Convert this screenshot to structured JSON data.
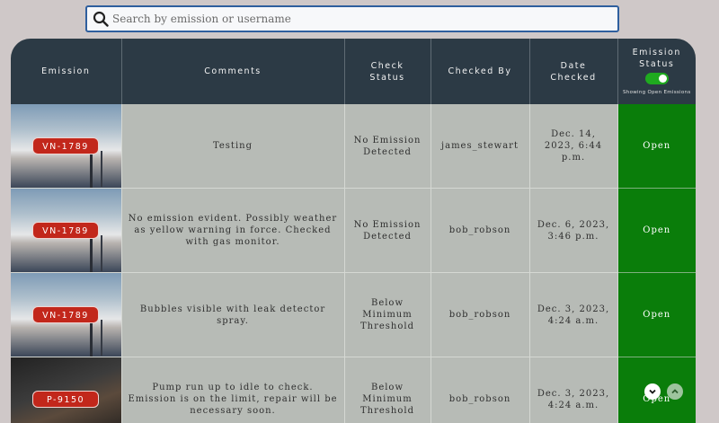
{
  "search": {
    "placeholder": "Search by emission or username",
    "icon": "search-icon"
  },
  "table": {
    "headers": {
      "emission": "Emission",
      "comments": "Comments",
      "check_status_1": "Check",
      "check_status_2": "Status",
      "checked_by": "Checked By",
      "date_1": "Date",
      "date_2": "Checked",
      "emission_status_1": "Emission",
      "emission_status_2": "Status",
      "toggle_caption": "Showing Open Emissions"
    },
    "rows": [
      {
        "emission": "VN-1789",
        "comments": "Testing",
        "check_status": "No Emission Detected",
        "checked_by": "james_stewart",
        "date": "Dec. 14, 2023, 6:44 p.m.",
        "status": "Open"
      },
      {
        "emission": "VN-1789",
        "comments": "No emission evident. Possibly weather as yellow warning in force. Checked with gas monitor.",
        "check_status": "No Emission Detected",
        "checked_by": "bob_robson",
        "date": "Dec. 6, 2023, 3:46 p.m.",
        "status": "Open"
      },
      {
        "emission": "VN-1789",
        "comments": "Bubbles visible with leak detector spray.",
        "check_status": "Below Minimum Threshold",
        "checked_by": "bob_robson",
        "date": "Dec. 3, 2023, 4:24 a.m.",
        "status": "Open"
      },
      {
        "emission": "P-9150",
        "comments": "Pump run up to idle to check. Emission is on the limit, repair will be necessary soon.",
        "check_status": "Below Minimum Threshold",
        "checked_by": "bob_robson",
        "date": "Dec. 3, 2023, 4:24 a.m.",
        "status": "Open"
      }
    ]
  },
  "colors": {
    "header_bg": "#2c3a45",
    "status_open": "#0a7d0a",
    "badge": "#c2271b",
    "toggle_on": "#1faa1f"
  }
}
